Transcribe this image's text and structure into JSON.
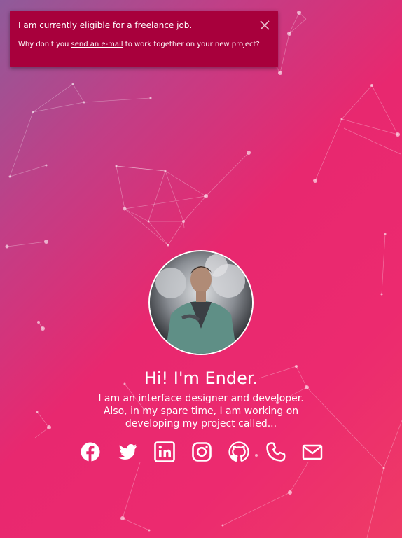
{
  "toast": {
    "title": "I am currently eligible for a freelance job.",
    "body_prefix": "Why don't you ",
    "link_text": "send an e-mail",
    "body_suffix": " to work together on your new project?",
    "background": "#a8003c"
  },
  "profile": {
    "greeting": "Hi! I'm Ender.",
    "bio_line1": "I am an interface designer and developer.",
    "bio_line2": "Also, in my spare time, I am working on",
    "bio_line3": "developing my project called..."
  },
  "socials": [
    {
      "icon": "facebook-icon"
    },
    {
      "icon": "twitter-icon"
    },
    {
      "icon": "linkedin-icon"
    },
    {
      "icon": "instagram-icon"
    },
    {
      "icon": "github-icon"
    },
    {
      "icon": "phone-icon"
    },
    {
      "icon": "mail-icon"
    }
  ],
  "colors": {
    "gradient_start": "#8f5b9a",
    "gradient_mid": "#e8286f",
    "gradient_end": "#ee3b66",
    "text": "#ffffff"
  }
}
